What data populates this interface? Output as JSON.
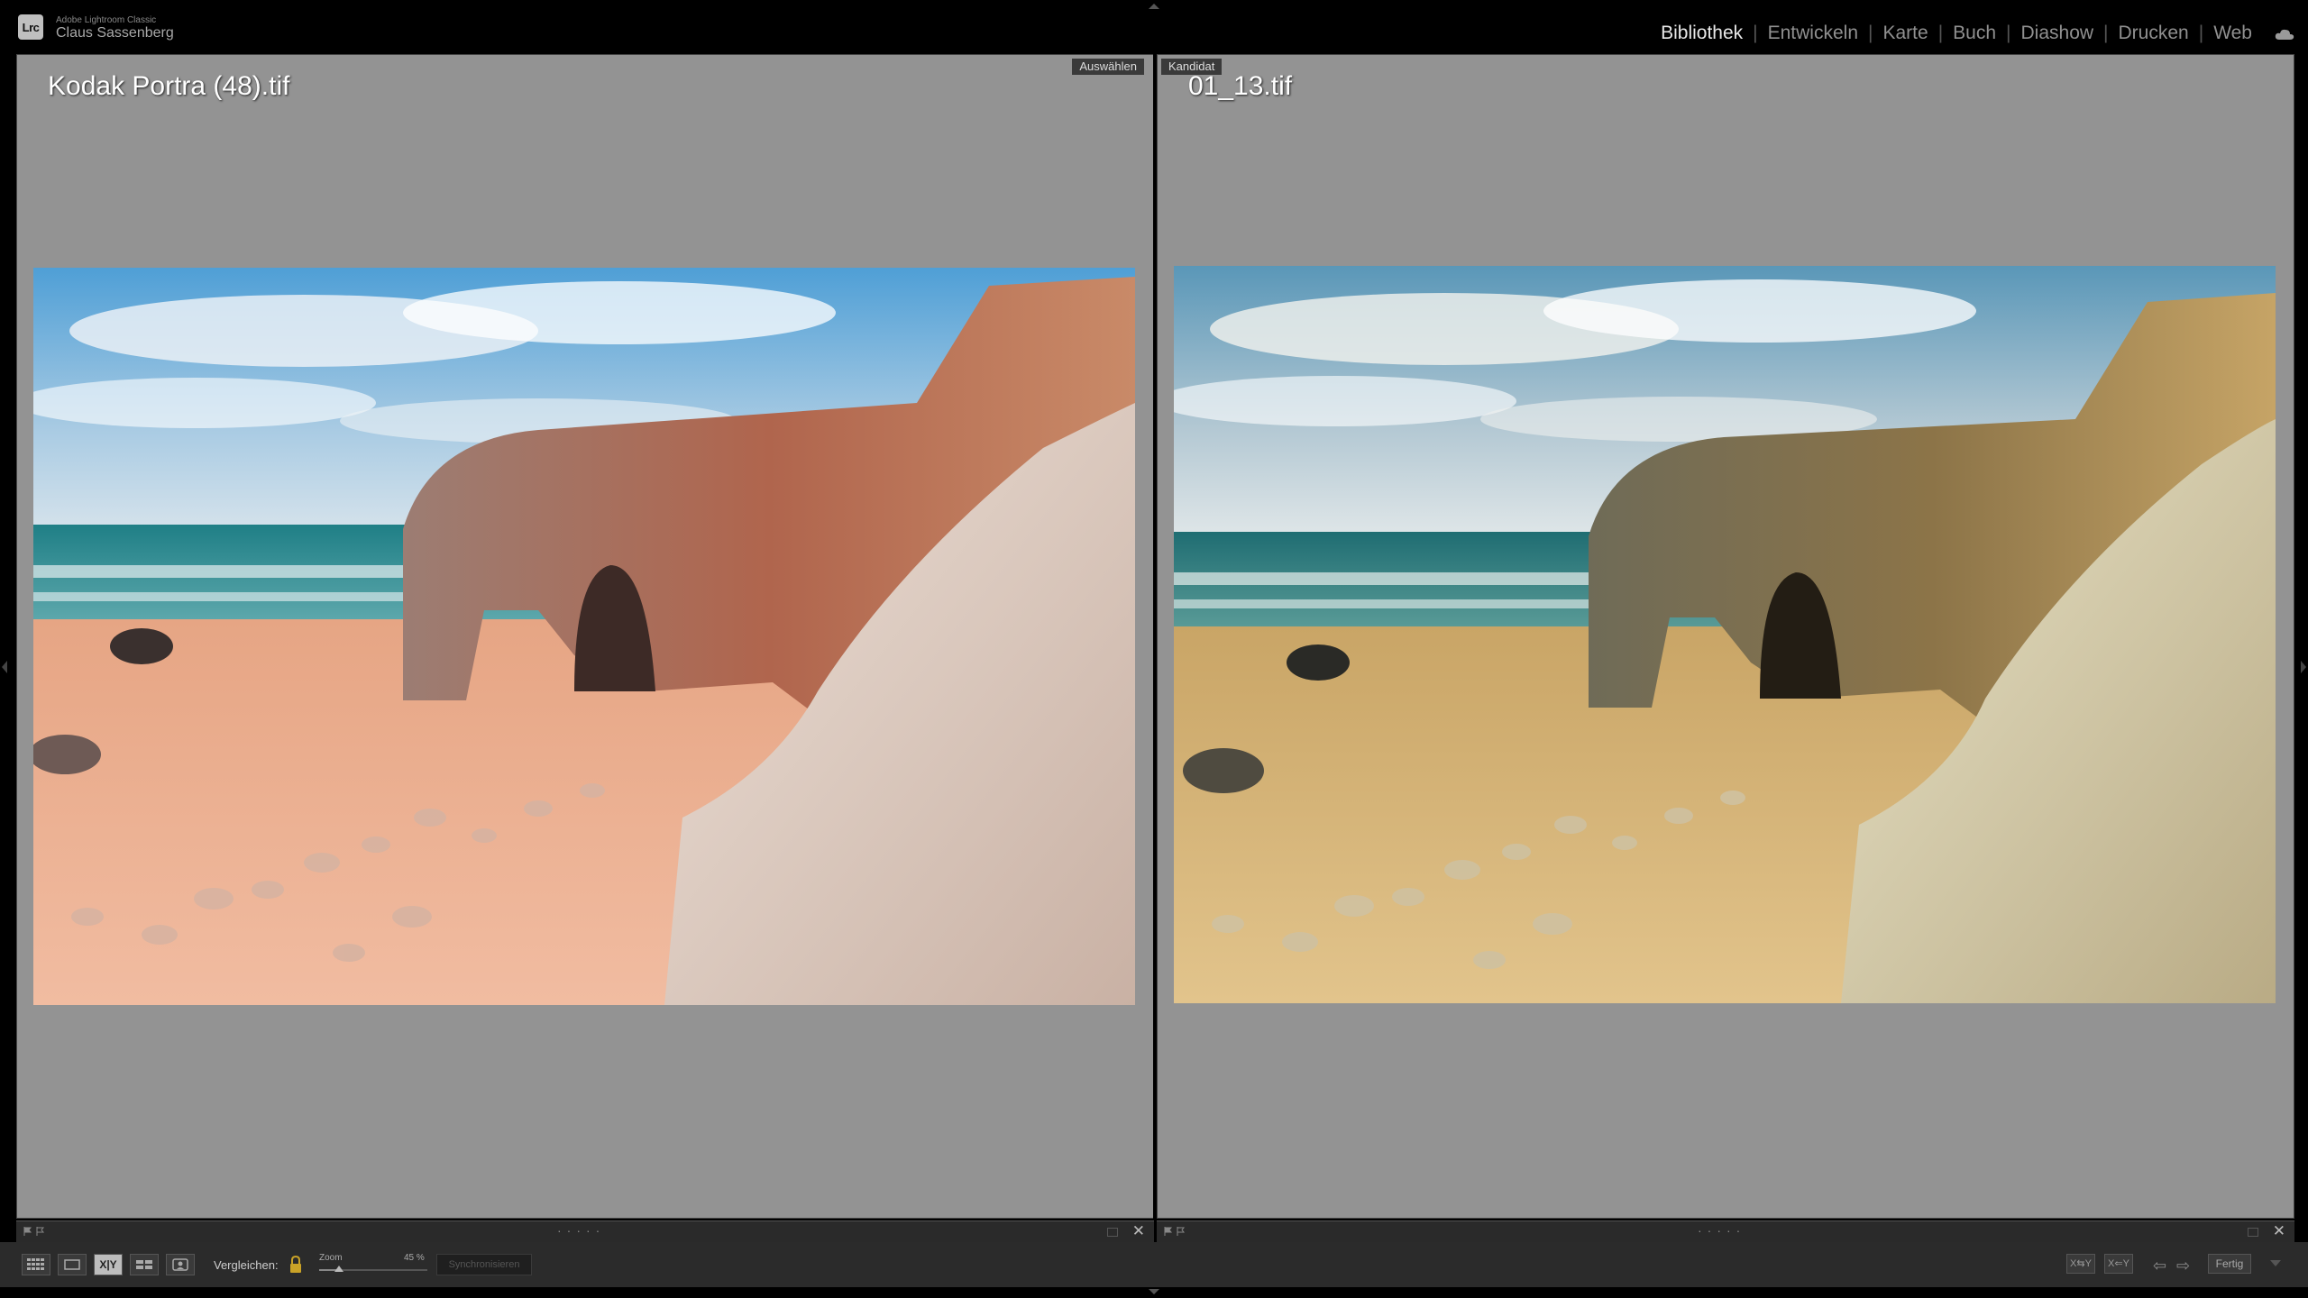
{
  "app": {
    "logo": "Lrc",
    "name": "Adobe Lightroom Classic",
    "user": "Claus Sassenberg"
  },
  "modules": [
    {
      "label": "Bibliothek",
      "active": true
    },
    {
      "label": "Entwickeln",
      "active": false
    },
    {
      "label": "Karte",
      "active": false
    },
    {
      "label": "Buch",
      "active": false
    },
    {
      "label": "Diashow",
      "active": false
    },
    {
      "label": "Drucken",
      "active": false
    },
    {
      "label": "Web",
      "active": false
    }
  ],
  "compare": {
    "select": {
      "tag": "Auswählen",
      "filename": "Kodak Portra (48).tif"
    },
    "candidate": {
      "tag": "Kandidat",
      "filename": "01_13.tif"
    }
  },
  "toolbar": {
    "compare_label": "Vergleichen:",
    "zoom_label": "Zoom",
    "zoom_value": "45 %",
    "zoom_fraction": 0.18,
    "sync_label": "Synchronisieren",
    "swap_label": "X⇆Y",
    "make_select_label": "X⇐Y",
    "done_label": "Fertig"
  },
  "colors": {
    "pane_bg": "#939393",
    "active_module": "#e8e8e8",
    "inactive_module": "#909090"
  }
}
